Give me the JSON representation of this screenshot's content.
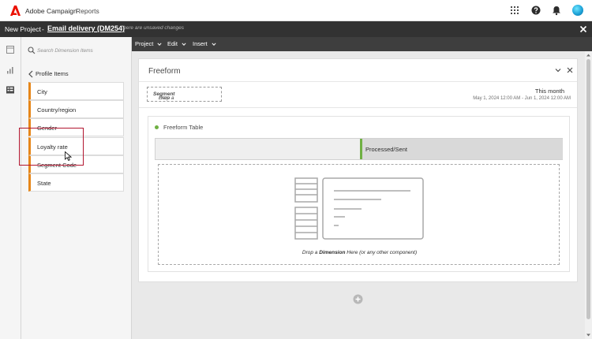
{
  "header": {
    "brand": "Adobe Campaign",
    "nav_reports": "Reports",
    "colors": {
      "brand_red": "#eb1000",
      "accent_blue": "#1ea3d8"
    }
  },
  "project_bar": {
    "new_project": "New Project",
    "separator": "-",
    "project_name": "Email delivery (DM254)",
    "unsaved_text": "There are unsaved changes"
  },
  "left_panel": {
    "search_placeholder": "Search Dimension Items",
    "back_label": "Profile Items",
    "items": [
      {
        "label": "City"
      },
      {
        "label": "Country/region"
      },
      {
        "label": "Gender"
      },
      {
        "label": "Loyalty rate"
      },
      {
        "label": "Segment Code"
      },
      {
        "label": "State"
      }
    ],
    "accent_color": "#e68619"
  },
  "toolbar": {
    "menus": [
      "Project",
      "Edit",
      "Insert"
    ]
  },
  "freeform": {
    "title": "Freeform",
    "segment_drop_prefix": "Drop a ",
    "segment_drop_bold": "Segment",
    "segment_drop_suffix": " Here",
    "date_label": "This month",
    "date_range": "May 1, 2024 12:00 AM - Jun 1, 2024 12:00 AM",
    "table": {
      "title": "Freeform Table",
      "metric_column": "Processed/Sent",
      "drop_prefix": "Drop a ",
      "drop_bold": "Dimension",
      "drop_suffix": " Here (or any other component)",
      "status_color": "#6fb043"
    }
  }
}
